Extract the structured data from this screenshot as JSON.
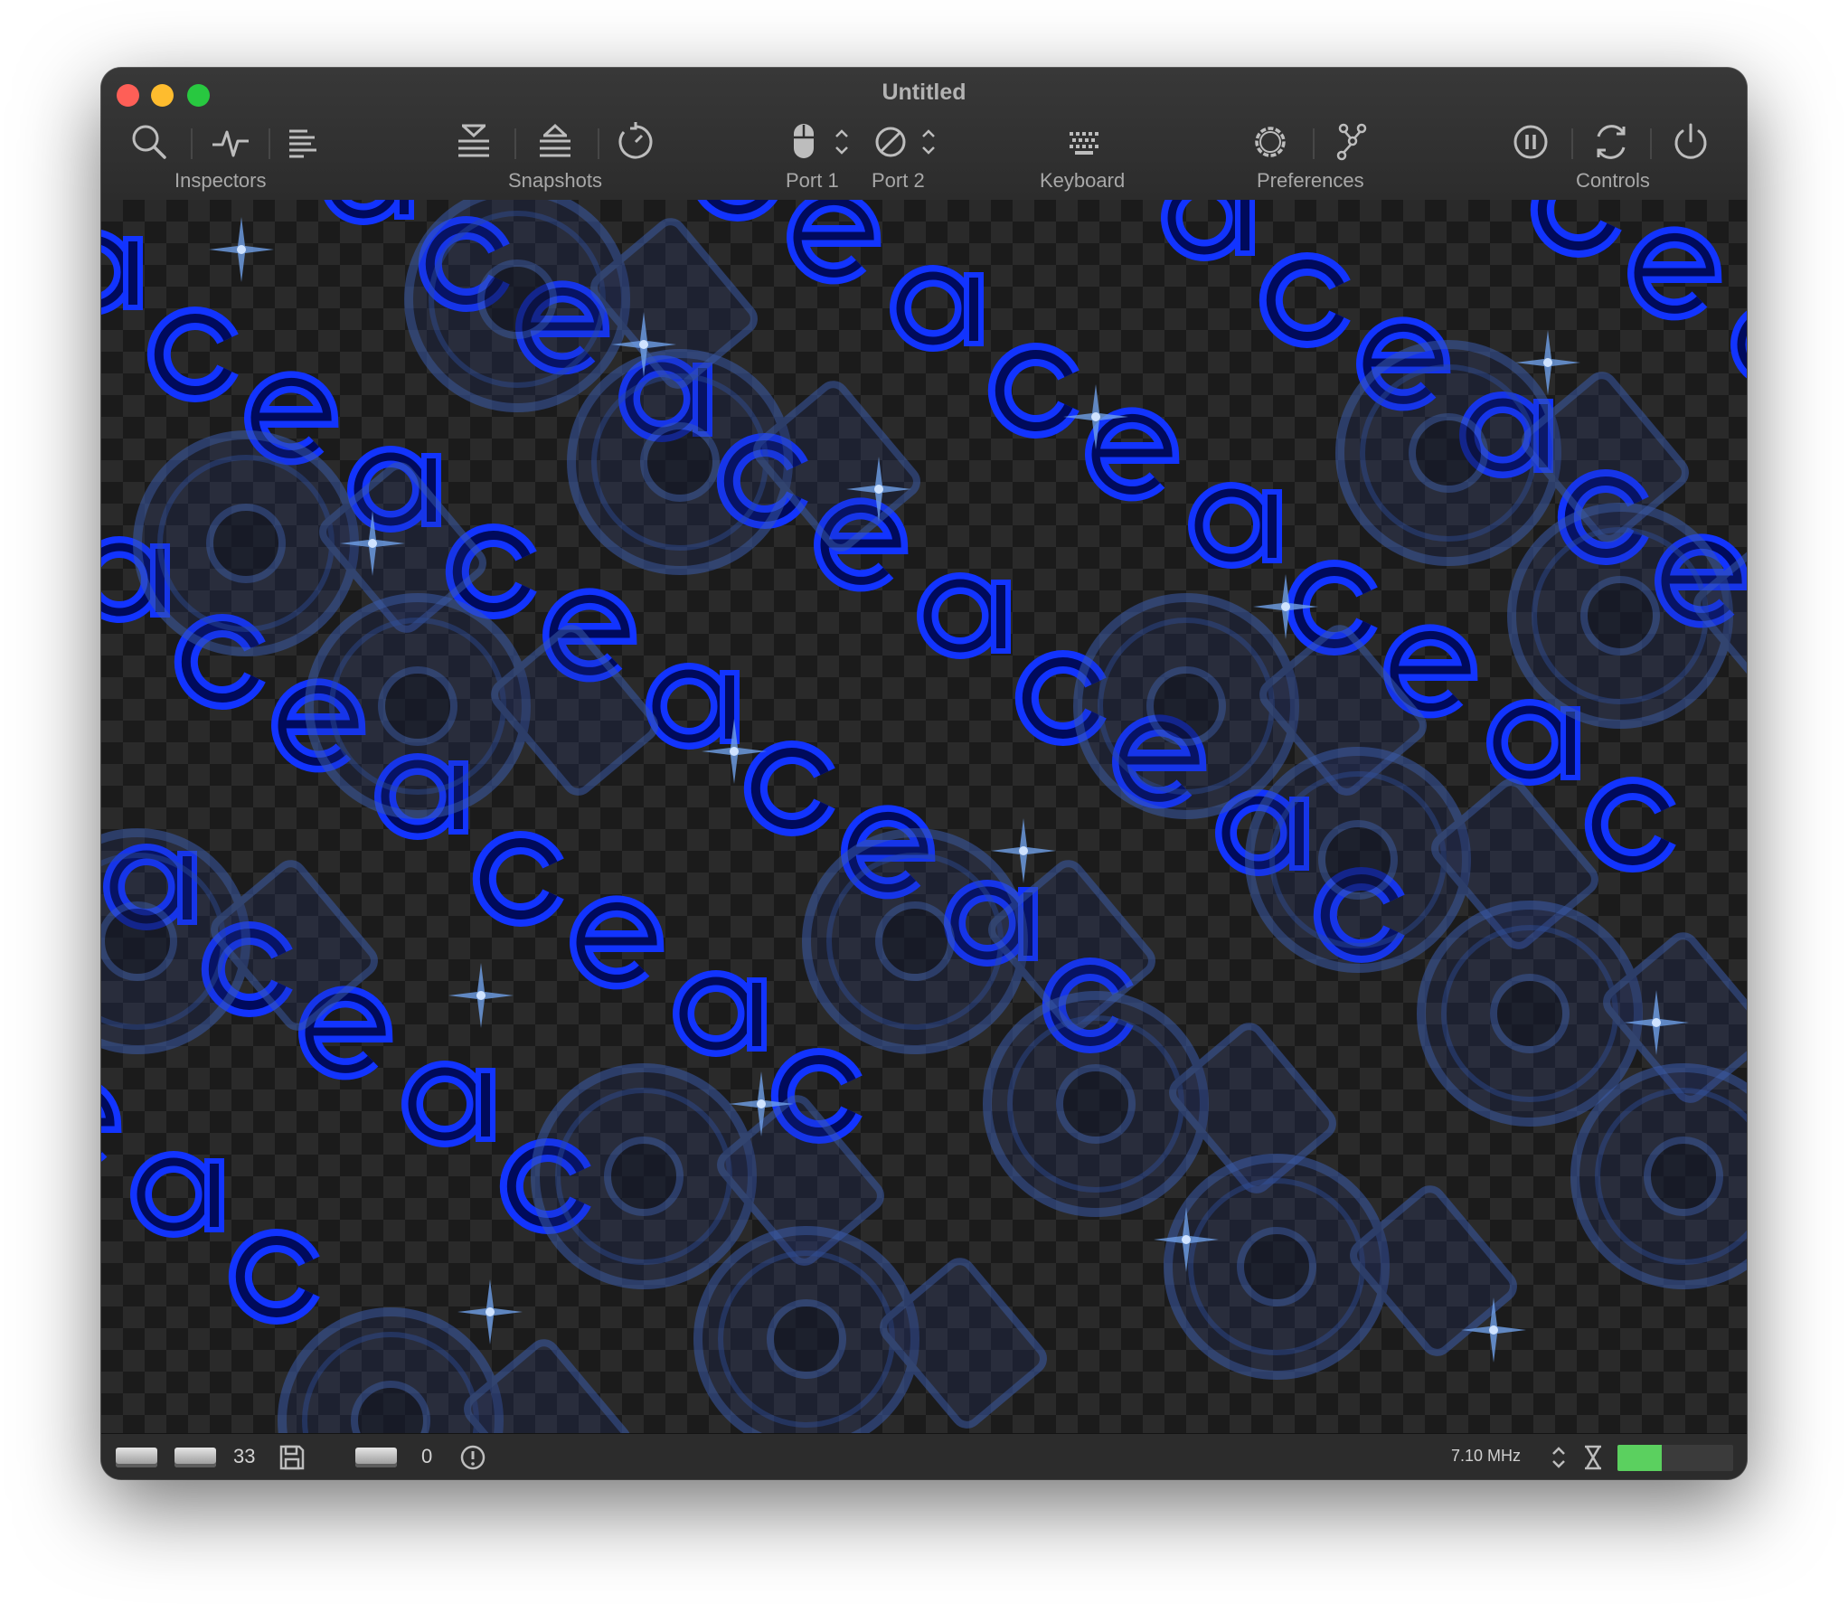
{
  "window": {
    "title": "Untitled"
  },
  "toolbar": {
    "inspectors_label": "Inspectors",
    "snapshots_label": "Snapshots",
    "port1_label": "Port 1",
    "port2_label": "Port 2",
    "keyboard_label": "Keyboard",
    "preferences_label": "Preferences",
    "controls_label": "Controls",
    "icons": [
      "search-icon",
      "activity-icon",
      "log-icon",
      "snapshot-take-icon",
      "snapshot-restore-icon",
      "rewind-clock-icon",
      "mouse-icon",
      "none-icon",
      "keyboard-icon",
      "gear-icon",
      "config-graph-icon",
      "pause-icon",
      "reset-icon",
      "power-icon"
    ]
  },
  "status": {
    "drive_count": "33",
    "port_count": "0",
    "clock_speed": "7.10 MHz",
    "cpu_load": 0.38
  },
  "colors": {
    "accent_blue": "#1f3bff",
    "meter_green": "#5bd05f",
    "titlebar": "#333333"
  }
}
